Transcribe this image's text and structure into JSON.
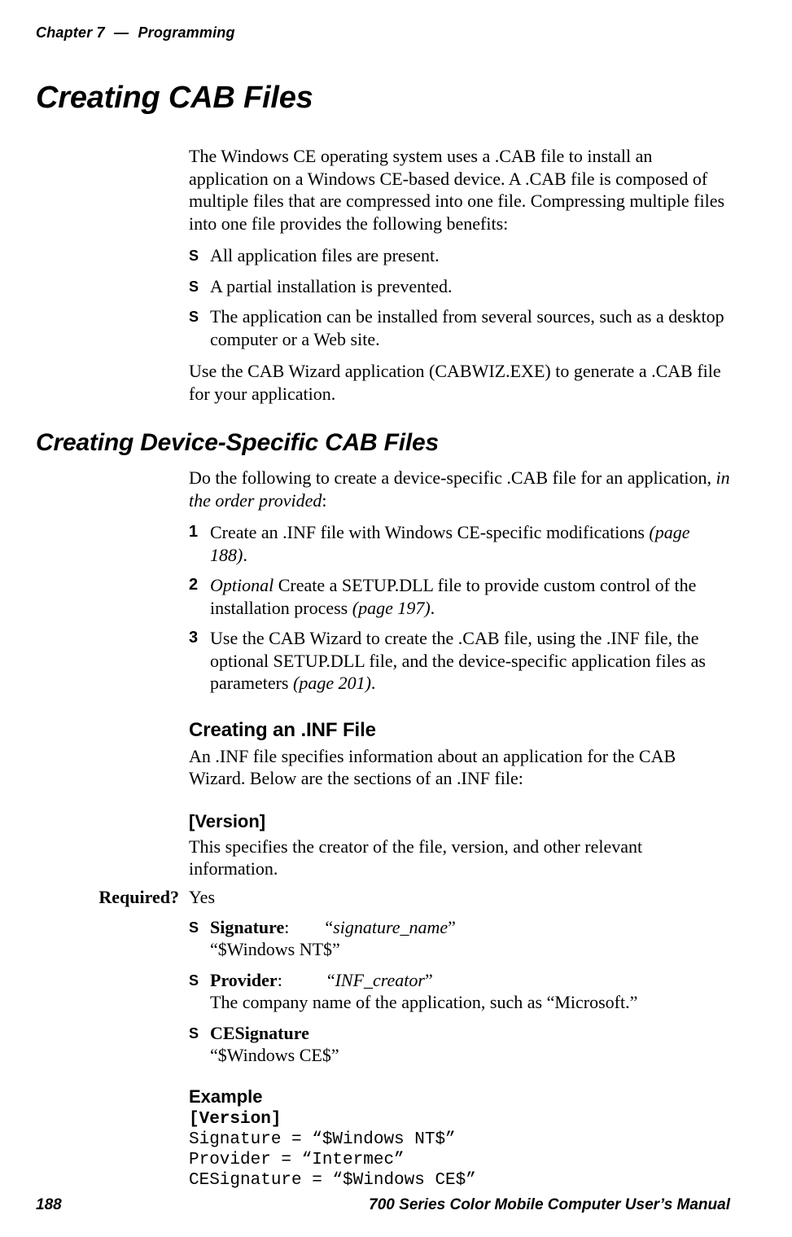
{
  "running_head": {
    "chapter": "Chapter 7",
    "dash": "—",
    "section": "Programming"
  },
  "h1": "Creating CAB Files",
  "intro_para": "The Windows CE operating system uses a .CAB file to install an application on a Windows CE-based device. A .CAB file is composed of multiple files that are compressed into one file. Compressing multiple files into one file provides the following benefits:",
  "intro_bullets": [
    "All application files are present.",
    "A partial installation is prevented.",
    "The application can be installed from several sources, such as a desktop computer or a Web site."
  ],
  "intro_para2": "Use the CAB Wizard application (CABWIZ.EXE) to generate a .CAB file for your application.",
  "h2": "Creating Device-Specific CAB Files",
  "cds_para_pre": "Do the following to create a device-specific .CAB file for an application, ",
  "cds_para_ital": "in the order provided",
  "cds_para_post": ":",
  "steps": [
    {
      "pre": "Create an .INF file with Windows CE-specific modifications ",
      "ital": "(page 188)",
      "post": "."
    },
    {
      "preital": "Optional",
      "mid": " Create a SETUP.DLL file to provide custom control of the installation process ",
      "ital": "(page 197)",
      "post": "."
    },
    {
      "pre": "Use the CAB Wizard to create the .CAB file, using the .INF file, the optional SETUP.DLL file, and the device-specific application files as parameters ",
      "ital": "(page 201)",
      "post": "."
    }
  ],
  "h3": "Creating an .INF File",
  "inf_para": "An .INF file specifies information about an application for the CAB Wizard. Below are the sections of an .INF file:",
  "h4": "[Version]",
  "version_para": "This specifies the creator of the file, version, and other relevant information.",
  "required_label": "Required?",
  "required_value": "Yes",
  "version_items": [
    {
      "name": "Signature",
      "sep": ":",
      "quoted_ital": "signature_name",
      "line2": "“$Windows NT$”"
    },
    {
      "name": "Provider",
      "sep": ":",
      "quoted_ital": "INF_creator",
      "line2": "The company name of the application, such as “Microsoft.”"
    },
    {
      "name": "CESignature",
      "line2": "“$Windows CE$”"
    }
  ],
  "h5": "Example",
  "example_lines": {
    "l1": "[Version]",
    "l2": "Signature = “$Windows NT$”",
    "l3": "Provider = “Intermec”",
    "l4": "CESignature = “$Windows CE$”"
  },
  "footer": {
    "page": "188",
    "manual": "700 Series Color Mobile Computer User’s Manual"
  },
  "glyphs": {
    "lq": "“",
    "rq": "”"
  }
}
